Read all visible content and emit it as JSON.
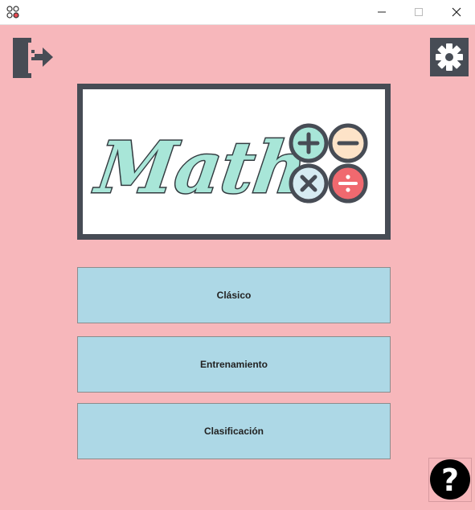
{
  "window": {
    "minimize_glyph": "—",
    "maximize_glyph": "☐",
    "close_glyph": "✕"
  },
  "toolbar": {
    "exit_icon": "exit-door-icon",
    "settings_icon": "gear-icon"
  },
  "logo": {
    "text": "Math",
    "operators": [
      "+",
      "−",
      "×",
      "÷"
    ]
  },
  "menu": {
    "classic_label": "Clásico",
    "training_label": "Entrenamiento",
    "ranking_label": "Clasificación"
  },
  "help": {
    "glyph": "?"
  },
  "colors": {
    "background": "#f7b7bb",
    "button": "#add8e6",
    "frame": "#474c55",
    "logo_text": "#a8e6d8",
    "plus": "#a8e6d8",
    "minus": "#fde3c8",
    "times": "#d6ebf2",
    "divide": "#f0696f"
  }
}
